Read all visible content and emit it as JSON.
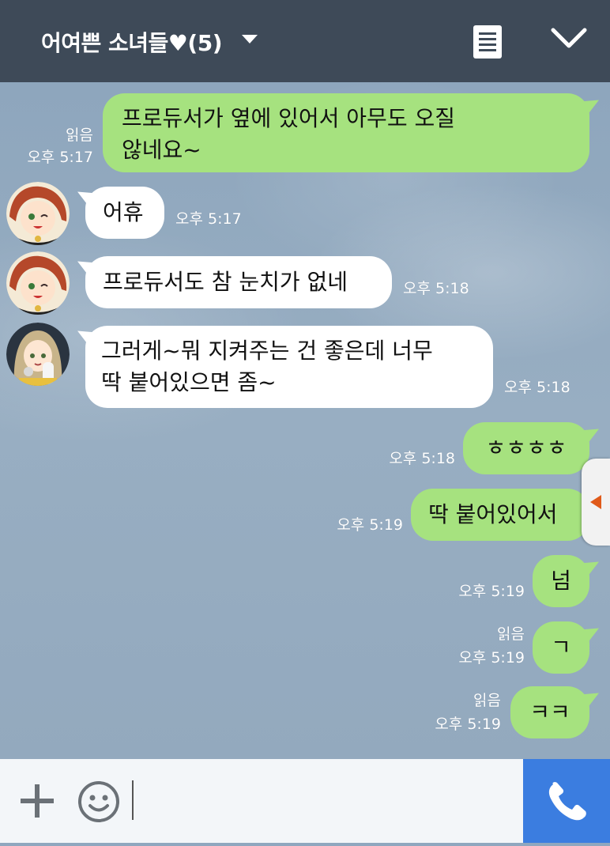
{
  "header": {
    "title": "어여쁜 소녀들♥(5)"
  },
  "messages": [
    {
      "side": "me",
      "text": "프로듀서가 옆에 있어서 아무도 오질\n않네요~",
      "read": "읽음",
      "time": "오후 5:17"
    },
    {
      "side": "other",
      "text": "어휴",
      "time": "오후 5:17"
    },
    {
      "side": "other",
      "text": "프로듀서도 참 눈치가 없네",
      "time": "오후 5:18"
    },
    {
      "side": "other",
      "text": "그러게~뭐 지켜주는 건 좋은데 너무\n딱 붙어있으면 좀~",
      "time": "오후 5:18"
    },
    {
      "side": "me",
      "text": "ㅎㅎㅎㅎ",
      "time": "오후 5:18"
    },
    {
      "side": "me",
      "text": "딱 붙어있어서",
      "time": "오후 5:19"
    },
    {
      "side": "me",
      "text": "넘",
      "time": "오후 5:19"
    },
    {
      "side": "me",
      "text": "ㄱ",
      "read": "읽음",
      "time": "오후 5:19"
    },
    {
      "side": "me",
      "text": "ㅋㅋ",
      "read": "읽음",
      "time": "오후 5:19"
    }
  ],
  "colors": {
    "header_bg": "#3e4a58",
    "my_bubble": "#a6e27f",
    "other_bubble": "#ffffff",
    "call_button": "#3b7de0"
  },
  "icons": {
    "menu": "list-icon",
    "collapse": "chevron-down-icon",
    "attach": "plus-icon",
    "emoji": "smiley-icon",
    "call": "phone-icon",
    "side_panel": "triangle-left-icon"
  }
}
